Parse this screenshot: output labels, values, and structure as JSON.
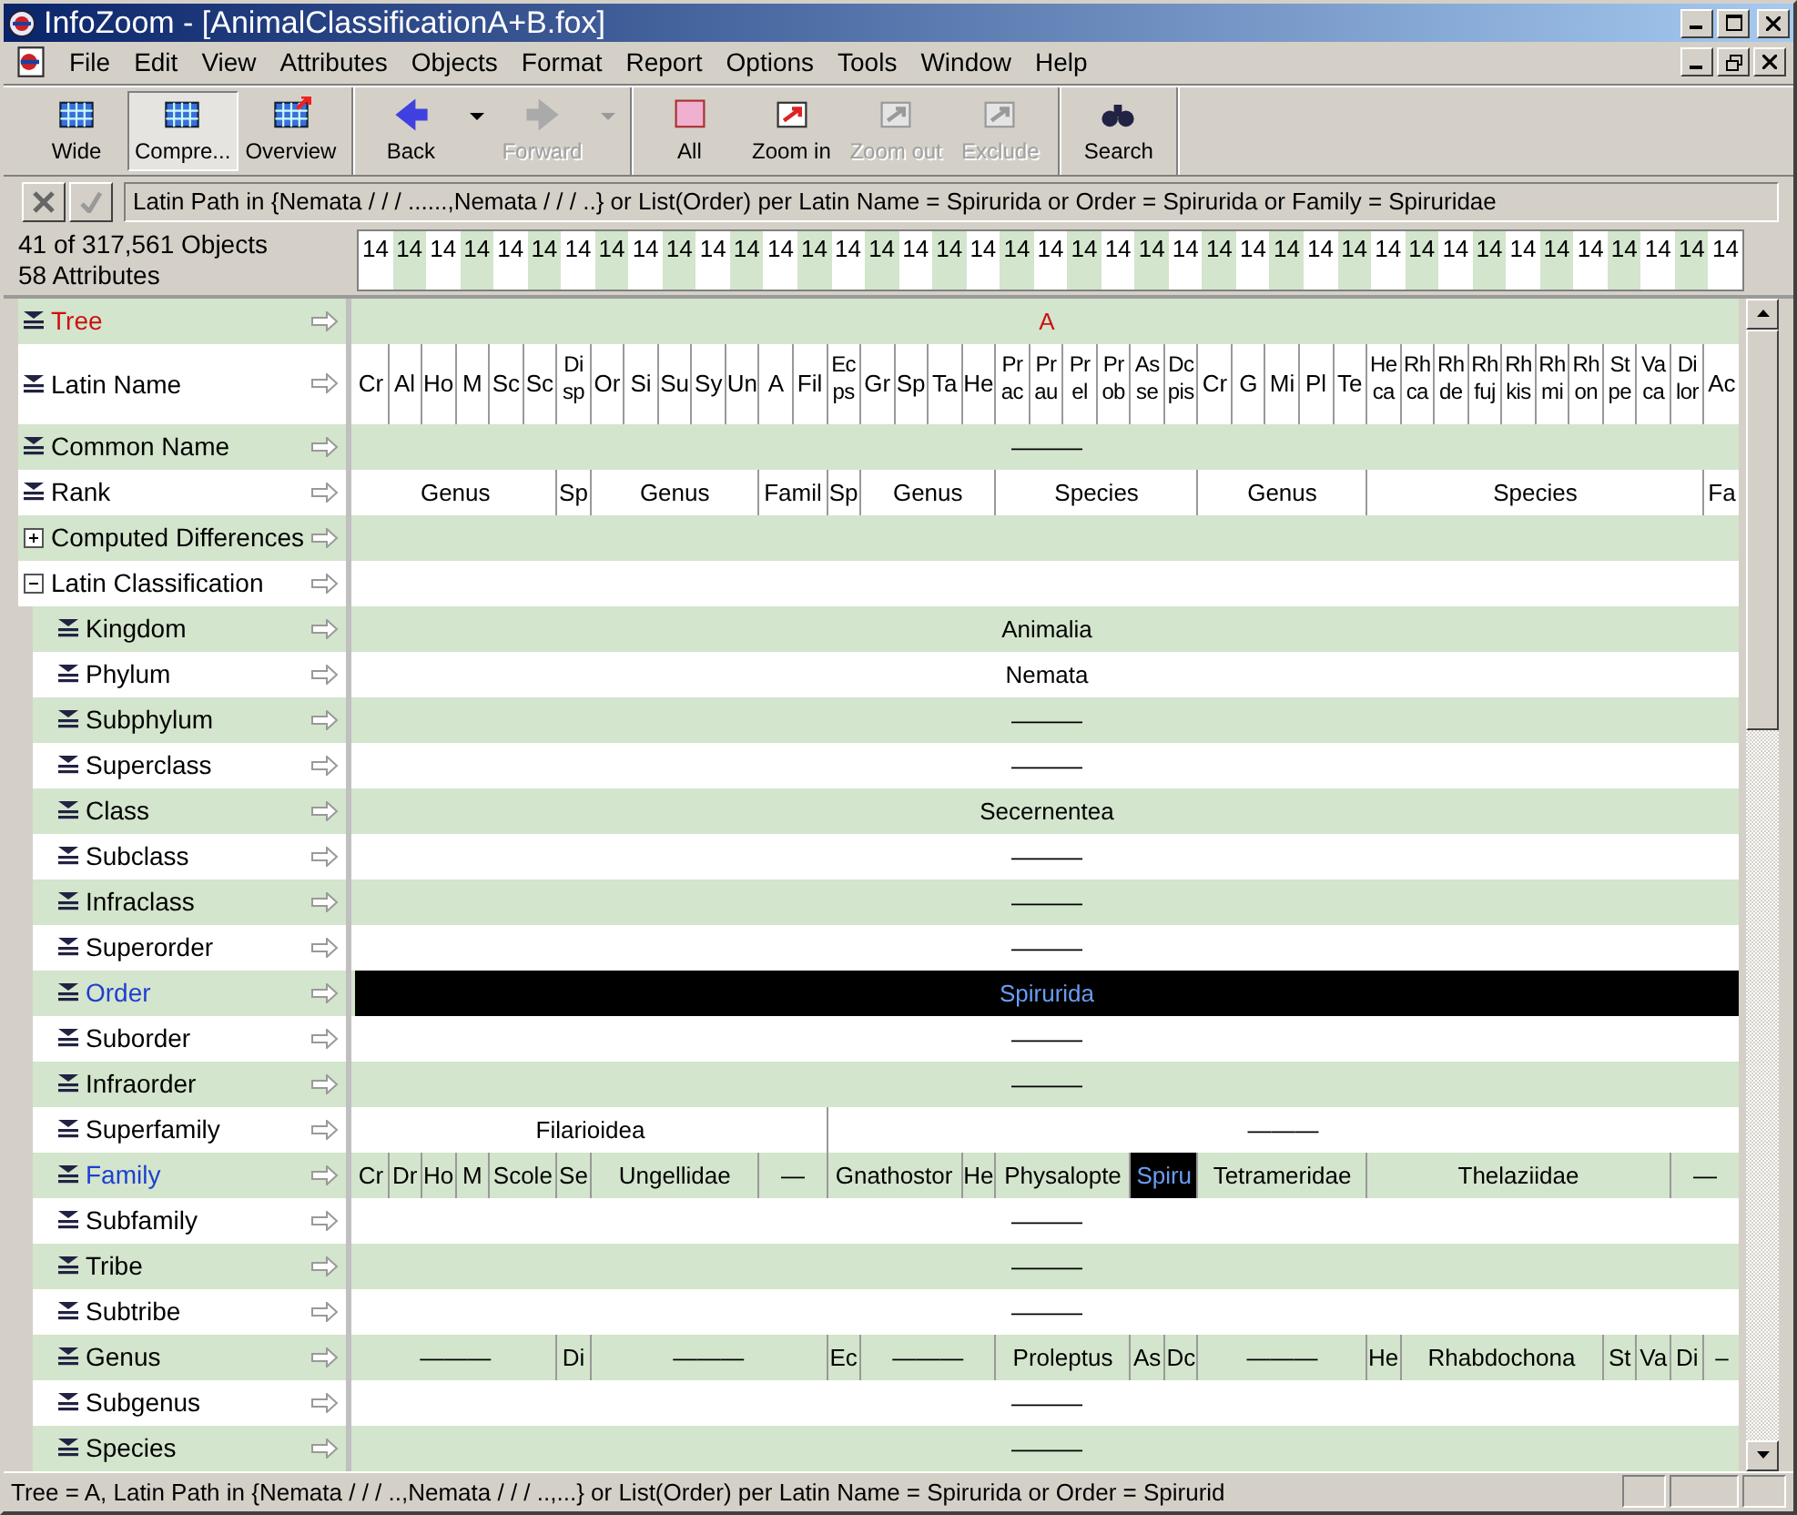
{
  "window": {
    "title": "InfoZoom - [AnimalClassificationA+B.fox]"
  },
  "menu": [
    "File",
    "Edit",
    "View",
    "Attributes",
    "Objects",
    "Format",
    "Report",
    "Options",
    "Tools",
    "Window",
    "Help"
  ],
  "toolbar_groups": [
    [
      {
        "label": "Wide",
        "kind": "button",
        "pressed": false,
        "disabled": false
      },
      {
        "label": "Compre...",
        "kind": "button",
        "pressed": true,
        "disabled": false
      },
      {
        "label": "Overview",
        "kind": "button",
        "pressed": false,
        "disabled": false
      }
    ],
    [
      {
        "label": "Back",
        "kind": "button",
        "pressed": false,
        "disabled": false
      },
      {
        "kind": "dropdown",
        "disabled": false
      },
      {
        "label": "Forward",
        "kind": "button",
        "pressed": false,
        "disabled": true
      },
      {
        "kind": "dropdown",
        "disabled": true
      }
    ],
    [
      {
        "label": "All",
        "kind": "button",
        "pressed": false,
        "disabled": false
      },
      {
        "label": "Zoom in",
        "kind": "button",
        "pressed": false,
        "disabled": false
      },
      {
        "label": "Zoom out",
        "kind": "button",
        "pressed": false,
        "disabled": true
      },
      {
        "label": "Exclude",
        "kind": "button",
        "pressed": false,
        "disabled": true
      }
    ],
    [
      {
        "label": "Search",
        "kind": "button",
        "pressed": false,
        "disabled": false
      }
    ]
  ],
  "filter": {
    "value": "Latin Path in {Nemata / / / ......,Nemata / / / ..} or List(Order) per Latin Name = Spirurida or Order = Spirurida or Family = Spiruridae",
    "apply_disabled": true
  },
  "summary": {
    "objects": "41 of 317,561 Objects",
    "attributes": "58 Attributes"
  },
  "column_counts": [
    "14",
    "14",
    "14",
    "14",
    "14",
    "14",
    "14",
    "14",
    "14",
    "14",
    "14",
    "14",
    "14",
    "14",
    "14",
    "14",
    "14",
    "14",
    "14",
    "14",
    "14",
    "14",
    "14",
    "14",
    "14",
    "14",
    "14",
    "14",
    "14",
    "14",
    "14",
    "14",
    "14",
    "14",
    "14",
    "14",
    "14",
    "14",
    "14",
    "14",
    "14"
  ],
  "attributes": [
    {
      "label": "Tree",
      "kind": "attribute",
      "color": "#cc1111",
      "selected": false,
      "cells": [
        {
          "text": "A",
          "color": "#cc1111"
        }
      ]
    },
    {
      "label": "Latin Name",
      "kind": "attribute",
      "selected": false,
      "cells": [
        {
          "text": "Cr"
        },
        {
          "text": "Al"
        },
        {
          "text": "Ho"
        },
        {
          "text": "M"
        },
        {
          "text": "Sc"
        },
        {
          "text": "Sc"
        },
        {
          "text": "Di\nsp"
        },
        {
          "text": "Or"
        },
        {
          "text": "Si"
        },
        {
          "text": "Su"
        },
        {
          "text": "Sy"
        },
        {
          "text": "Un"
        },
        {
          "text": "A"
        },
        {
          "text": "Fil"
        },
        {
          "text": "Ec\nps"
        },
        {
          "text": "Gr"
        },
        {
          "text": "Sp"
        },
        {
          "text": "Ta"
        },
        {
          "text": "He"
        },
        {
          "text": "Pr\nac"
        },
        {
          "text": "Pr\nau"
        },
        {
          "text": "Pr\nel"
        },
        {
          "text": "Pr\nob"
        },
        {
          "text": "As\nse"
        },
        {
          "text": "Dc\npis"
        },
        {
          "text": "Cr"
        },
        {
          "text": "G"
        },
        {
          "text": "Mi"
        },
        {
          "text": "Pl"
        },
        {
          "text": "Te"
        },
        {
          "text": "He\nca"
        },
        {
          "text": "Rh\nca"
        },
        {
          "text": "Rh\nde"
        },
        {
          "text": "Rh\nfuj"
        },
        {
          "text": "Rh\nkis"
        },
        {
          "text": "Rh\nmi"
        },
        {
          "text": "Rh\non"
        },
        {
          "text": "St\npe"
        },
        {
          "text": "Va\nca"
        },
        {
          "text": "Di\nlor"
        },
        {
          "text": "Ac"
        }
      ]
    },
    {
      "label": "Common Name",
      "kind": "attribute",
      "selected": false,
      "cells": [
        {
          "text": "———"
        }
      ]
    },
    {
      "label": "Rank",
      "kind": "attribute",
      "selected": false,
      "cells": [
        {
          "text": "Genus"
        },
        {
          "text": "Sp"
        },
        {
          "text": "Genus"
        },
        {
          "text": "Famil"
        },
        {
          "text": "Sp"
        },
        {
          "text": "Genus"
        },
        {
          "text": "Species"
        },
        {
          "text": "Genus"
        },
        {
          "text": "Species"
        },
        {
          "text": "Fa"
        }
      ]
    },
    {
      "label": "Computed Differences",
      "kind": "group",
      "expanded": false,
      "selected": false
    },
    {
      "label": "Latin Classification",
      "kind": "group",
      "expanded": true,
      "selected": false,
      "children": [
        {
          "label": "Kingdom",
          "kind": "attribute",
          "selected": false,
          "cells": [
            {
              "text": "Animalia"
            }
          ]
        },
        {
          "label": "Phylum",
          "kind": "attribute",
          "selected": false,
          "cells": [
            {
              "text": "Nemata"
            }
          ]
        },
        {
          "label": "Subphylum",
          "kind": "attribute",
          "selected": false,
          "cells": [
            {
              "text": "———"
            }
          ]
        },
        {
          "label": "Superclass",
          "kind": "attribute",
          "selected": false,
          "cells": [
            {
              "text": "———"
            }
          ]
        },
        {
          "label": "Class",
          "kind": "attribute",
          "selected": false,
          "cells": [
            {
              "text": "Secernentea"
            }
          ]
        },
        {
          "label": "Subclass",
          "kind": "attribute",
          "selected": false,
          "cells": [
            {
              "text": "———"
            }
          ]
        },
        {
          "label": "Infraclass",
          "kind": "attribute",
          "selected": false,
          "cells": [
            {
              "text": "———"
            }
          ]
        },
        {
          "label": "Superorder",
          "kind": "attribute",
          "selected": false,
          "cells": [
            {
              "text": "———"
            }
          ]
        },
        {
          "label": "Order",
          "kind": "attribute",
          "color": "#1f3fd0",
          "selected": true,
          "cells": [
            {
              "text": "Spirurida"
            }
          ]
        },
        {
          "label": "Suborder",
          "kind": "attribute",
          "selected": false,
          "cells": [
            {
              "text": "———"
            }
          ]
        },
        {
          "label": "Infraorder",
          "kind": "attribute",
          "selected": false,
          "cells": [
            {
              "text": "———"
            }
          ]
        },
        {
          "label": "Superfamily",
          "kind": "attribute",
          "selected": false,
          "cells": [
            {
              "text": "Filarioidea"
            },
            {
              "text": "———"
            }
          ]
        },
        {
          "label": "Family",
          "kind": "attribute",
          "color": "#1f3fd0",
          "selected": false,
          "cells": [
            {
              "text": "Cr",
              "selected": false
            },
            {
              "text": "Dr",
              "selected": false
            },
            {
              "text": "Ho",
              "selected": false
            },
            {
              "text": "M",
              "selected": false
            },
            {
              "text": "Scole",
              "selected": false
            },
            {
              "text": "Se",
              "selected": false
            },
            {
              "text": "Ungellidae",
              "selected": false
            },
            {
              "text": "—",
              "selected": false
            },
            {
              "text": "Gnathostor",
              "selected": false
            },
            {
              "text": "He",
              "selected": false
            },
            {
              "text": "Physalopte",
              "selected": false
            },
            {
              "text": "Spiru",
              "selected": true
            },
            {
              "text": "Tetrameridae",
              "selected": false
            },
            {
              "text": "Thelaziidae",
              "selected": false
            },
            {
              "text": "—",
              "selected": false
            }
          ]
        },
        {
          "label": "Subfamily",
          "kind": "attribute",
          "selected": false,
          "cells": [
            {
              "text": "———"
            }
          ]
        },
        {
          "label": "Tribe",
          "kind": "attribute",
          "selected": false,
          "cells": [
            {
              "text": "———"
            }
          ]
        },
        {
          "label": "Subtribe",
          "kind": "attribute",
          "selected": false,
          "cells": [
            {
              "text": "———"
            }
          ]
        },
        {
          "label": "Genus",
          "kind": "attribute",
          "selected": false,
          "cells": [
            {
              "text": "———"
            },
            {
              "text": "Di"
            },
            {
              "text": "———"
            },
            {
              "text": "Ec"
            },
            {
              "text": "———"
            },
            {
              "text": "Proleptus"
            },
            {
              "text": "As"
            },
            {
              "text": "Dc"
            },
            {
              "text": "———"
            },
            {
              "text": "He"
            },
            {
              "text": "Rhabdochona"
            },
            {
              "text": "St"
            },
            {
              "text": "Va"
            },
            {
              "text": "Di"
            },
            {
              "text": "–"
            }
          ]
        },
        {
          "label": "Subgenus",
          "kind": "attribute",
          "selected": false,
          "cells": [
            {
              "text": "———"
            }
          ]
        },
        {
          "label": "Species",
          "kind": "attribute",
          "selected": false,
          "cells": [
            {
              "text": "———"
            }
          ]
        }
      ]
    }
  ],
  "status_bar": {
    "text": "Tree = A, Latin Path in {Nemata / / / ..,Nemata / / / ..,...} or List(Order) per Latin Name = Spirurida or Order = Spirurid"
  }
}
